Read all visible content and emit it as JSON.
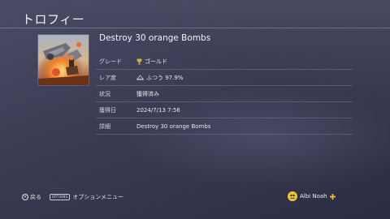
{
  "header": {
    "title": "トロフィー"
  },
  "trophy": {
    "name": "Destroy 30 orange Bombs",
    "rows": [
      {
        "label": "グレード",
        "value": "ゴールド",
        "icon": "gold-trophy-icon"
      },
      {
        "label": "レア度",
        "value": "ふつう 97.9%",
        "icon": "rarity-common-icon"
      },
      {
        "label": "状況",
        "value": "獲得済み"
      },
      {
        "label": "獲得日",
        "value": "2024/7/13 7:56"
      },
      {
        "label": "詳細",
        "value": "Destroy 30 orange Bombs"
      }
    ]
  },
  "footer": {
    "back_glyph": "✕",
    "back_label": "戻る",
    "options_glyph": "OPTIONS",
    "options_label": "オプションメニュー"
  },
  "user": {
    "name": "Albi Noah",
    "icon": "playstation-plus-icon"
  },
  "colors": {
    "gold": "#d9a93a",
    "plus": "#f1c232",
    "avatar": "#e8c43a"
  }
}
